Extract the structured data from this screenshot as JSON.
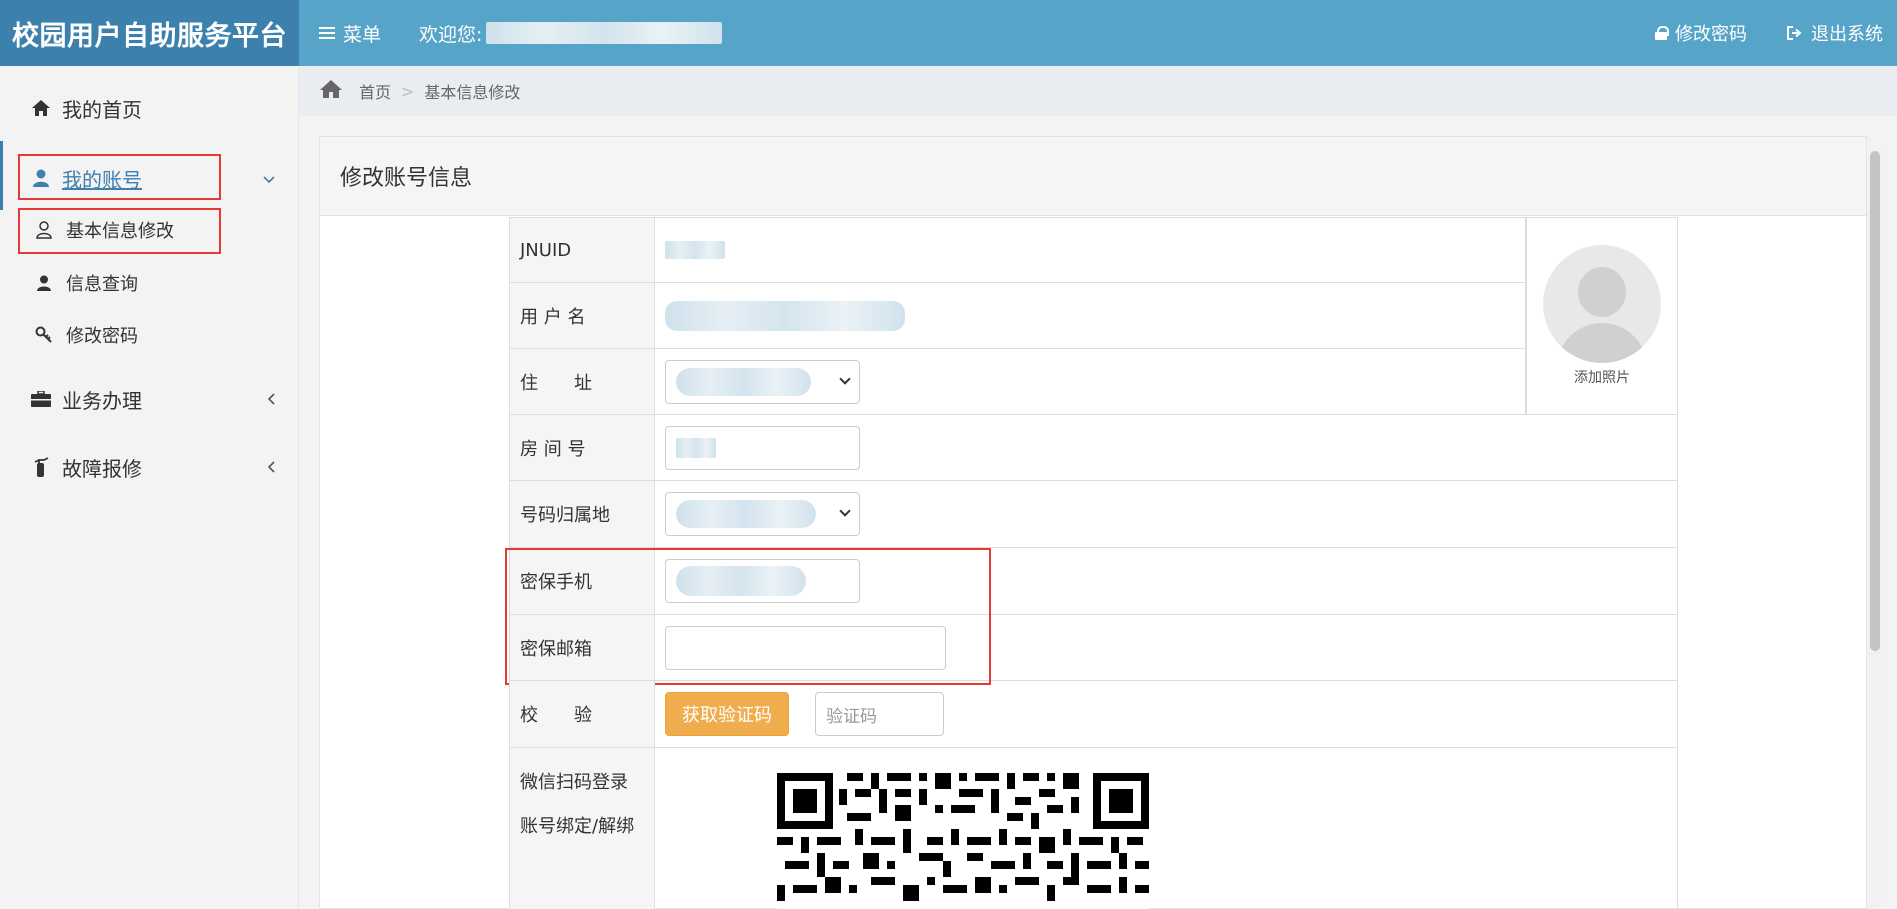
{
  "header": {
    "brand": "校园用户自助服务平台",
    "menu_label": "菜单",
    "welcome_label": "欢迎您:",
    "change_password": "修改密码",
    "logout": "退出系统"
  },
  "sidebar": {
    "items": [
      {
        "label": "我的首页",
        "icon": "home-icon"
      },
      {
        "label": "我的账号",
        "icon": "user-icon"
      },
      {
        "label": "基本信息修改",
        "icon": "user-outline-icon"
      },
      {
        "label": "信息查询",
        "icon": "user-icon"
      },
      {
        "label": "修改密码",
        "icon": "key-icon"
      },
      {
        "label": "业务办理",
        "icon": "briefcase-icon"
      },
      {
        "label": "故障报修",
        "icon": "extinguisher-icon"
      }
    ]
  },
  "breadcrumb": {
    "home": "首页",
    "separator": ">",
    "current": "基本信息修改"
  },
  "panel": {
    "title": "修改账号信息"
  },
  "form": {
    "jnuid_label": "JNUID",
    "username_label": "用 户 名",
    "address_label": "住　　址",
    "room_label": "房 间 号",
    "location_label": "号码归属地",
    "phone_label": "密保手机",
    "email_label": "密保邮箱",
    "verify_label": "校　　验",
    "get_code_button": "获取验证码",
    "code_placeholder": "验证码",
    "wechat_label_1": "微信扫码登录",
    "wechat_label_2": "账号绑定/解绑",
    "add_photo": "添加照片"
  },
  "colors": {
    "header": "#57a4c9",
    "brand_bg": "#3c80ad",
    "button_orange": "#f0ad4e",
    "highlight": "#e53935"
  }
}
